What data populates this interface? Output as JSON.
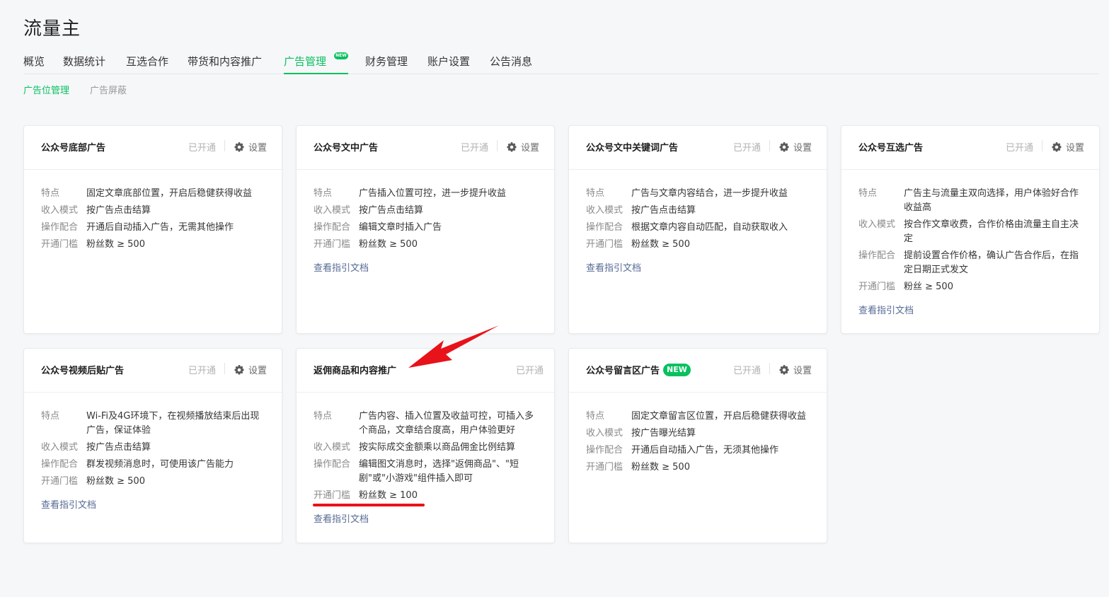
{
  "app": {
    "title": "流量主"
  },
  "nav": {
    "tabs": [
      "概览",
      "数据统计",
      "互选合作",
      "带货和内容推广",
      "广告管理",
      "财务管理",
      "账户设置",
      "公告消息"
    ],
    "active_badge": "NEW"
  },
  "subnav": {
    "tabs": [
      "广告位管理",
      "广告屏蔽"
    ]
  },
  "labels": {
    "feature": "特点",
    "income": "收入模式",
    "operation": "操作配合",
    "threshold": "开通门槛",
    "status": "已开通",
    "settings": "设置",
    "doc_link": "查看指引文档",
    "new_badge": "NEW"
  },
  "cards": [
    {
      "title": "公众号底部广告",
      "feature": "固定文章底部位置，开启后稳健获得收益",
      "income": "按广告点击结算",
      "operation": "开通后自动插入广告，无需其他操作",
      "threshold": "粉丝数 ≥ 500"
    },
    {
      "title": "公众号文中广告",
      "feature": "广告插入位置可控，进一步提升收益",
      "income": "按广告点击结算",
      "operation": "编辑文章时插入广告",
      "threshold": "粉丝数 ≥ 500"
    },
    {
      "title": "公众号文中关键词广告",
      "feature": "广告与文章内容结合，进一步提升收益",
      "income": "按广告点击结算",
      "operation": "根据文章内容自动匹配，自动获取收入",
      "threshold": "粉丝数 ≥ 500"
    },
    {
      "title": "公众号互选广告",
      "feature": "广告主与流量主双向选择，用户体验好合作收益高",
      "income": "按合作文章收费，合作价格由流量主自主决定",
      "operation": "提前设置合作价格，确认广告合作后，在指定日期正式发文",
      "threshold": "粉丝 ≥ 500"
    },
    {
      "title": "公众号视频后贴广告",
      "feature": "Wi-Fi及4G环境下，在视频播放结束后出现广告，保证体验",
      "income": "按广告点击结算",
      "operation": "群发视频消息时，可使用该广告能力",
      "threshold": "粉丝数 ≥ 500"
    },
    {
      "title": "返佣商品和内容推广",
      "feature": "广告内容、插入位置及收益可控，可插入多个商品，文章结合度高，用户体验更好",
      "income": "按实际成交金额乘以商品佣金比例结算",
      "operation": "编辑图文消息时，选择\"返佣商品\"、\"短剧\"或\"小游戏\"组件插入即可",
      "threshold": "粉丝数 ≥ 100"
    },
    {
      "title": "公众号留言区广告",
      "feature": "固定文章留言区位置，开启后稳健获得收益",
      "income": "按广告曝光结算",
      "operation": "开通后自动插入广告，无须其他操作",
      "threshold": "粉丝数 ≥ 500"
    }
  ],
  "colors": {
    "accent": "#07c160",
    "link": "#576b95",
    "annotation": "#e8121a"
  }
}
